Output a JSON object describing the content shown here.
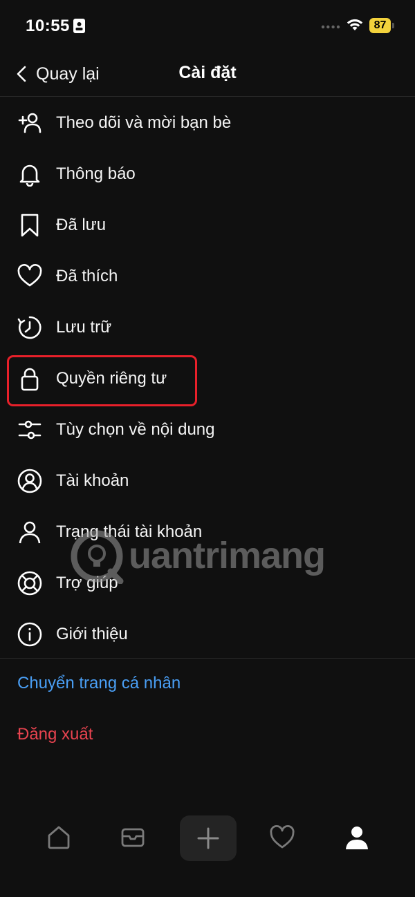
{
  "status_bar": {
    "time": "10:55",
    "battery": "87",
    "battery_color": "#f3d23c"
  },
  "header": {
    "back_label": "Quay lại",
    "title": "Cài đặt"
  },
  "menu": {
    "items": [
      {
        "label": "Theo dõi và mời bạn bè",
        "icon": "add-person-icon"
      },
      {
        "label": "Thông báo",
        "icon": "bell-icon"
      },
      {
        "label": "Đã lưu",
        "icon": "bookmark-icon"
      },
      {
        "label": "Đã thích",
        "icon": "heart-icon"
      },
      {
        "label": "Lưu trữ",
        "icon": "archive-clock-icon"
      },
      {
        "label": "Quyền riêng tư",
        "icon": "lock-icon"
      },
      {
        "label": "Tùy chọn về nội dung",
        "icon": "sliders-icon"
      },
      {
        "label": "Tài khoản",
        "icon": "account-circle-icon"
      },
      {
        "label": "Trạng thái tài khoản",
        "icon": "person-icon"
      },
      {
        "label": "Trợ giúp",
        "icon": "lifebuoy-icon"
      },
      {
        "label": "Giới thiệu",
        "icon": "info-icon"
      }
    ]
  },
  "links": {
    "switch_profile": "Chuyển trang cá nhân",
    "logout": "Đăng xuất"
  },
  "colors": {
    "background": "#101010",
    "link_blue": "#4a9ff5",
    "logout_red": "#e8434f",
    "highlight_red": "#e8202a"
  },
  "watermark": "uantrimang",
  "tab_bar": [
    "home-icon",
    "message-icon",
    "compose-plus-icon",
    "activity-heart-icon",
    "profile-icon"
  ]
}
